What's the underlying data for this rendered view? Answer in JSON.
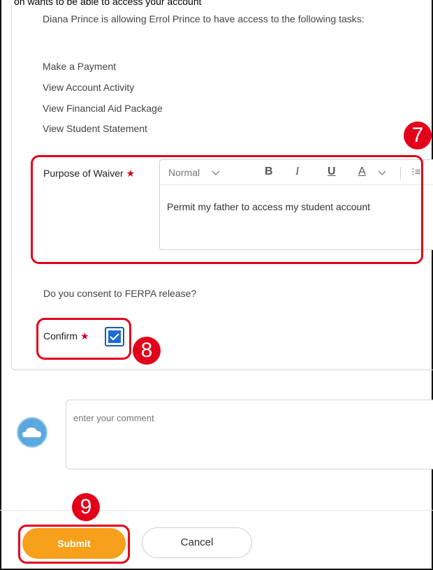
{
  "header": {
    "cut_text": "on wants to be able to access your account"
  },
  "form": {
    "intro": "Diana Prince is allowing Errol Prince to have access to the following tasks:",
    "tasks": [
      "Make a Payment",
      "View Account Activity",
      "View Financial Aid Package",
      "View Student Statement"
    ],
    "purpose_label": "Purpose of Waiver",
    "required_mark": "★",
    "editor": {
      "style_select": "Normal",
      "bold": "B",
      "italic": "I",
      "underline": "U",
      "font_color": "A",
      "list_icon": "⁝≡",
      "text": "Permit my father to access my student account"
    },
    "consent_question": "Do you consent to FERPA release?",
    "confirm_label": "Confirm",
    "confirm_checked": true
  },
  "comment": {
    "placeholder": "enter your comment",
    "avatar_icon": "cloud-icon"
  },
  "actions": {
    "submit": "Submit",
    "cancel": "Cancel"
  },
  "callouts": {
    "step_7": "7",
    "step_8": "8",
    "step_9": "9"
  },
  "colors": {
    "callout_red": "#e3001b",
    "submit_orange": "#f6a01c",
    "checkbox_blue": "#1e6bd6",
    "required_red": "#d0021b"
  }
}
